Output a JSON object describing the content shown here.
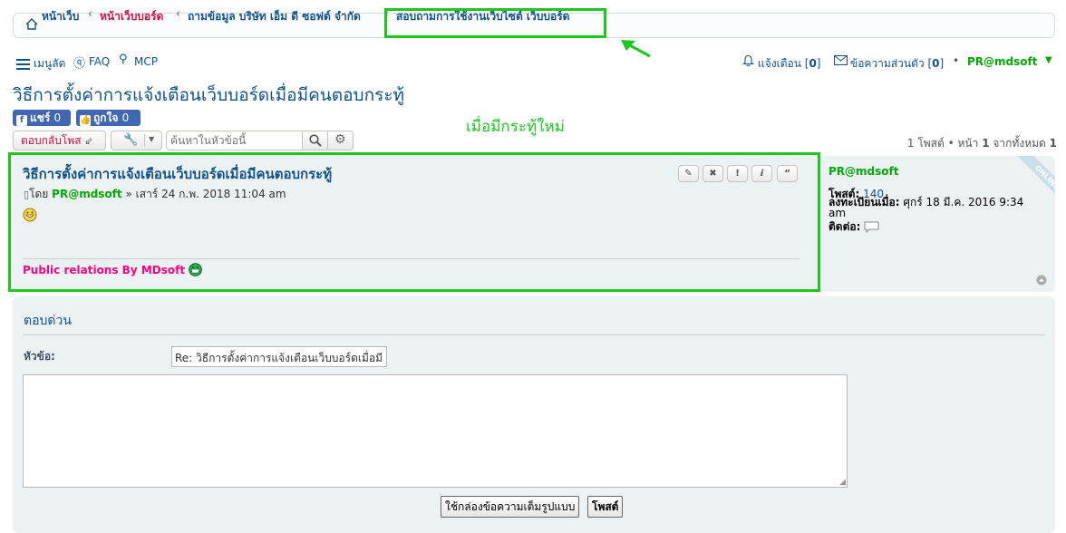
{
  "breadcrumb": {
    "home": "หน้าเว็บ",
    "board_index": "หน้าเว็บบอร์ด",
    "forum": "ถามข้อมูล บริษัท เอ็ม ดี ซอฟต์ จำกัด",
    "topic_forum": "สอบถามการใช้งานเว็บไซต์ เว็บบอร์ด"
  },
  "nav": {
    "quick_links": "เมนูลัด",
    "faq": "FAQ",
    "mcp": "MCP",
    "notifications_label": "แจ้งเตือน",
    "notifications_count": "0",
    "pm_label": "ข้อความส่วนตัว",
    "pm_count": "0",
    "username": "PR@mdsoft"
  },
  "topic_title": "วิธีการตั้งค่าการแจ้งเตือนเว็บบอร์ดเมื่อมีคนตอบกระทู้",
  "facebook": {
    "share_label": "แชร์",
    "share_count": "0",
    "like_label": "ถูกใจ",
    "like_count": "0"
  },
  "annotation_text": "เมื่อมีกระทู้ใหม่",
  "action_bar": {
    "reply_label": "ตอบกลับโพส",
    "search_placeholder": "ค้นหาในหัวข้อนี้",
    "pagination": {
      "posts_count": "1",
      "posts_label": "โพสต์",
      "page_label": "หน้า",
      "current_page": "1",
      "of_label": "จากทั้งหมด",
      "total_pages": "1"
    }
  },
  "post": {
    "title": "วิธีการตั้งค่าการแจ้งเตือนเว็บบอร์ดเมื่อมีคนตอบกระทู้",
    "by_label": "โดย",
    "author": "PR@mdsoft",
    "date": "» เสาร์ 24 ก.พ. 2018 11:04 am",
    "buttons": [
      "edit",
      "delete",
      "report",
      "info",
      "quote"
    ],
    "signature": "Public relations By MDsoft"
  },
  "profile": {
    "name": "PR@mdsoft",
    "online_badge": "ONLINE",
    "posts_label": "โพสต์:",
    "posts_value": "140",
    "joined_label": "ลงทะเบียนเมื่อ:",
    "joined_value": "ศุกร์ 18 มี.ค. 2016 9:34",
    "joined_value_cont": "am",
    "contact_label": "ติดต่อ:"
  },
  "quick_reply": {
    "title": "ตอบด่วน",
    "subject_label": "หัวข้อ:",
    "subject_value": "Re: วิธีการตั้งค่าการแจ้งเตือนเว็บบอร์ดเมื่อมี",
    "message_value": "",
    "full_editor_label": "ใช้กล่องข้อความเต็มรูปแบบ",
    "post_label": "โพสต์"
  },
  "colors": {
    "highlight_green": "#1ec61e",
    "link_blue": "#105289",
    "breadcrumb_red": "#d31141",
    "author_green": "#00aa00",
    "signature_pink": "#ff0084",
    "facebook_blue": "#4267b2"
  }
}
